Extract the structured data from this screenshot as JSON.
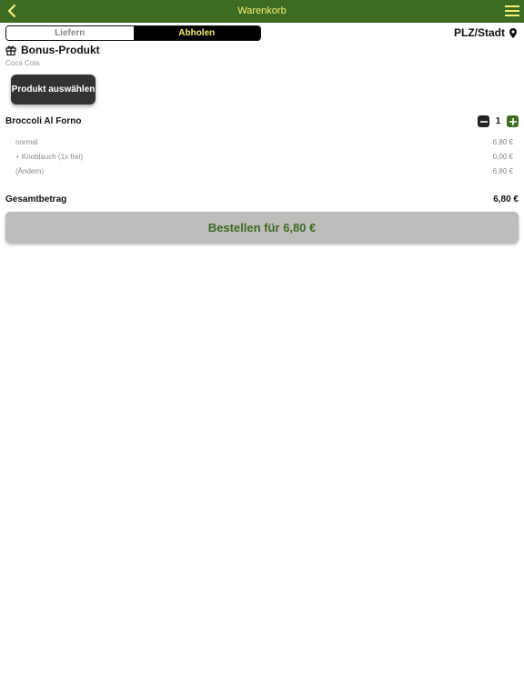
{
  "header": {
    "title": "Warenkorb",
    "back_icon": "chevron-left-icon",
    "menu_icon": "hamburger-menu-icon"
  },
  "mode_tabs": [
    {
      "label": "Liefern",
      "active": false
    },
    {
      "label": "Abholen",
      "active": true
    }
  ],
  "location": {
    "label": "PLZ/Stadt",
    "icon": "map-pin-icon"
  },
  "bonus": {
    "title": "Bonus-Produkt",
    "subtitle": "Coca Cola",
    "icon": "gift-icon",
    "button_label": "Produkt auswählen"
  },
  "cart": {
    "items": [
      {
        "name": "Broccoli Al Forno",
        "quantity": "1",
        "lines": [
          {
            "label": "normal",
            "price": "6,80 €"
          },
          {
            "label": "+ Knoblauch (1x frei)",
            "price": "0,00 €"
          },
          {
            "label": "(Ändern)",
            "price": "6,80 €"
          }
        ]
      }
    ],
    "total_label": "Gesamtbetrag",
    "total_value": "6,80 €",
    "order_button_label": "Bestellen für 6,80 €"
  },
  "colors": {
    "brand_green": "#3d6b22",
    "title_yellow": "#f5f075",
    "button_dark": "#333333",
    "order_button_bg": "#bdbdbb"
  }
}
